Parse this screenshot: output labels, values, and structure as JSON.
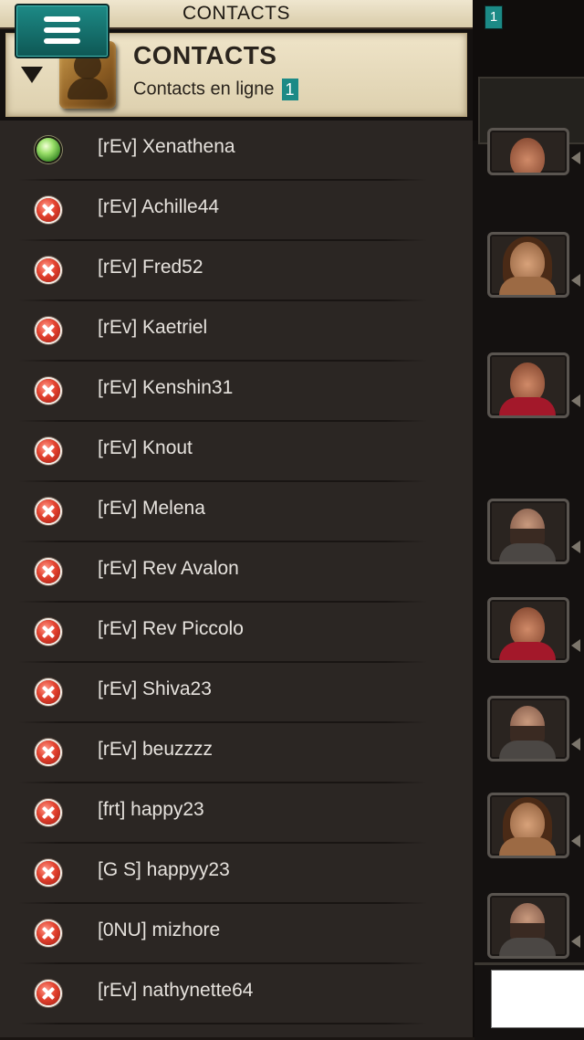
{
  "title_strip": {
    "label": "CONTACTS"
  },
  "header": {
    "title": "CONTACTS",
    "subtitle": "Contacts en ligne",
    "online_count": "1",
    "icon": "contact-book-icon",
    "collapse_icon": "triangle-down-icon"
  },
  "contacts": [
    {
      "name": "[rEv] Xenathena",
      "status": "online"
    },
    {
      "name": "[rEv] Achille44",
      "status": "offline"
    },
    {
      "name": "[rEv] Fred52",
      "status": "offline"
    },
    {
      "name": "[rEv] Kaetriel",
      "status": "offline"
    },
    {
      "name": "[rEv] Kenshin31",
      "status": "offline"
    },
    {
      "name": "[rEv] Knout",
      "status": "offline"
    },
    {
      "name": "[rEv] Melena",
      "status": "offline"
    },
    {
      "name": "[rEv] Rev Avalon",
      "status": "offline"
    },
    {
      "name": "[rEv] Rev Piccolo",
      "status": "offline"
    },
    {
      "name": "[rEv] Shiva23",
      "status": "offline"
    },
    {
      "name": "[rEv] beuzzzz",
      "status": "offline"
    },
    {
      "name": "[frt] happy23",
      "status": "offline"
    },
    {
      "name": "[G S] happyy23",
      "status": "offline"
    },
    {
      "name": "[0NU] mizhore",
      "status": "offline"
    },
    {
      "name": "[rEv] nathynette64",
      "status": "offline"
    }
  ],
  "side_panel": {
    "menu_badge": "1",
    "menu_icon": "hamburger-menu-icon"
  },
  "colors": {
    "accent_teal": "#1c8a86",
    "online_green": "#6fc04a",
    "offline_red": "#e3422f",
    "list_background": "#2b2623",
    "header_parchment": "#e6dbbd"
  }
}
